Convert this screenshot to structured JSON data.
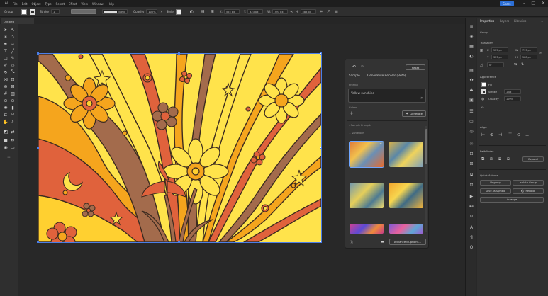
{
  "menu": {
    "logo": "Ai",
    "items": [
      "File",
      "Edit",
      "Object",
      "Type",
      "Select",
      "Effect",
      "View",
      "Window",
      "Help"
    ],
    "share": "Share"
  },
  "control": {
    "fill_label": "Fill",
    "stroke_label": "Stroke",
    "stroke_weight": "Basic",
    "opacity_label": "Opacity",
    "opacity_value": "100%",
    "style_label": "Style",
    "x_value": "525 px",
    "y_value": "323 px",
    "w_value": "793 px",
    "h_value": "588 px"
  },
  "document": {
    "tab_label": "Untitled"
  },
  "genpanel": {
    "reset": "Reset",
    "preset_label": "Sample",
    "title": "Generative Recolor (Beta)",
    "prompt_label": "Prompt",
    "prompt_value": "Yellow sunshine",
    "colors_label": "Colors",
    "generate": "Generate",
    "sample_prompts": "Sample Prompts",
    "variations": "Variations",
    "advanced": "Advanced Options..."
  },
  "props": {
    "tab_properties": "Properties",
    "tab_layers": "Layers",
    "tab_libraries": "Libraries",
    "group_label": "Group",
    "transform": "Transform",
    "x": "525 px",
    "y": "323 px",
    "w": "793 px",
    "h": "588 px",
    "angle": "0°",
    "appearance": "Appearance",
    "fill": "Fill",
    "stroke": "Stroke",
    "stroke_val": "1 px",
    "opacity": "Opacity",
    "opacity_val": "100%",
    "fx": "fx",
    "align": "Align",
    "pathfinder": "Pathfinder",
    "expand": "Expand",
    "quick_actions": "Quick Actions",
    "ungroup": "Ungroup",
    "isolate": "Isolate Group",
    "save_symbol": "Save as Symbol",
    "recolor": "Recolor",
    "arrange": "Arrange"
  },
  "colors": {
    "accent": "#2c6fd6",
    "yellow": "#ffe34b",
    "orange": "#f5a51d",
    "coral": "#e0623c",
    "brown": "#a36b4c",
    "outline": "#3c2b20"
  }
}
